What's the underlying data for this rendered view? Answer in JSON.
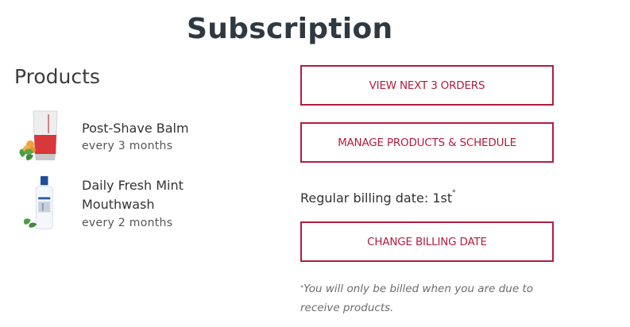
{
  "title": "Subscription",
  "products_heading": "Products",
  "products": [
    {
      "name": "Post-Shave Balm",
      "frequency": "every 3 months",
      "icon": "balm-tube-icon"
    },
    {
      "name": "Daily Fresh Mint Mouthwash",
      "frequency": "every 2 months",
      "icon": "mouthwash-bottle-icon"
    }
  ],
  "actions": {
    "view_orders": "VIEW NEXT 3 ORDERS",
    "manage": "MANAGE PRODUCTS & SCHEDULE",
    "change_billing": "CHANGE BILLING DATE"
  },
  "billing": {
    "label": "Regular billing date: 1st",
    "marker": "*"
  },
  "footnote": {
    "marker": "*",
    "text": "You will only be billed when you are due to receive products."
  },
  "colors": {
    "accent": "#b51c3c",
    "title": "#2f3942"
  }
}
